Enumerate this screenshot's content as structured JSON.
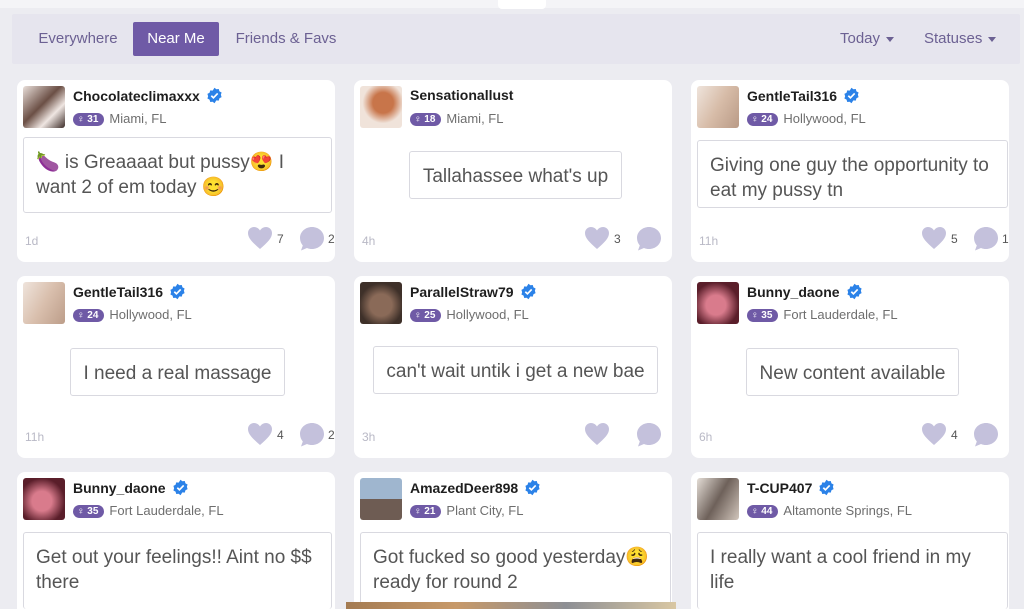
{
  "filters": {
    "tabs": [
      {
        "label": "Everywhere",
        "active": false
      },
      {
        "label": "Near Me",
        "active": true
      },
      {
        "label": "Friends & Favs",
        "active": false
      }
    ],
    "time_dropdown": "Today",
    "status_dropdown": "Statuses"
  },
  "accent_color": "#6f5aa6",
  "posts": [
    {
      "username": "Chocolateclimaxxx",
      "age": "31",
      "location": "Miami, FL",
      "message": "🍆 is Greaaaat but pussy😍 I want 2 of em today 😊",
      "time": "1d",
      "likes": "7",
      "comments": "2"
    },
    {
      "username": "Sensationallust",
      "age": "18",
      "location": "Miami, FL",
      "message": "Tallahassee what's up",
      "time": "4h",
      "likes": "3",
      "comments": ""
    },
    {
      "username": "GentleTail316",
      "age": "24",
      "location": "Hollywood, FL",
      "message": "Giving one guy the opportunity to eat my pussy tn",
      "time": "11h",
      "likes": "5",
      "comments": "1"
    },
    {
      "username": "GentleTail316",
      "age": "24",
      "location": "Hollywood, FL",
      "message": "I need a real massage",
      "time": "11h",
      "likes": "4",
      "comments": "2"
    },
    {
      "username": "ParallelStraw79",
      "age": "25",
      "location": "Hollywood, FL",
      "message": "can't wait untik i get a new bae",
      "time": "3h",
      "likes": "",
      "comments": ""
    },
    {
      "username": "Bunny_daone",
      "age": "35",
      "location": "Fort Lauderdale, FL",
      "message": "New content available",
      "time": "6h",
      "likes": "4",
      "comments": ""
    },
    {
      "username": "Bunny_daone",
      "age": "35",
      "location": "Fort Lauderdale, FL",
      "message": "Get out your feelings!! Aint no $$ there",
      "time": "",
      "likes": "",
      "comments": ""
    },
    {
      "username": "AmazedDeer898",
      "age": "21",
      "location": "Plant City, FL",
      "message": "Got fucked so good yesterday😩 ready for round 2",
      "time": "",
      "likes": "",
      "comments": ""
    },
    {
      "username": "T-CUP407",
      "age": "44",
      "location": "Altamonte Springs, FL",
      "message": "I really want a cool friend in my life",
      "time": "",
      "likes": "",
      "comments": ""
    }
  ]
}
